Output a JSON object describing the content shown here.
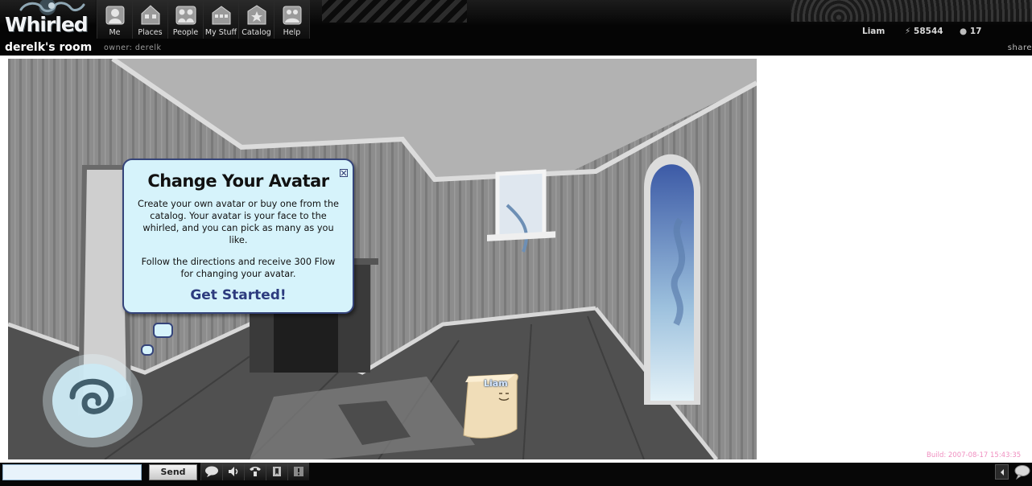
{
  "header": {
    "logo": "Whirled",
    "nav": [
      {
        "id": "me",
        "label": "Me",
        "icon": "person-icon"
      },
      {
        "id": "places",
        "label": "Places",
        "icon": "house-icon"
      },
      {
        "id": "people",
        "label": "People",
        "icon": "people-icon"
      },
      {
        "id": "mystuff",
        "label": "My Stuff",
        "icon": "stuff-icon"
      },
      {
        "id": "catalog",
        "label": "Catalog",
        "icon": "catalog-icon"
      },
      {
        "id": "help",
        "label": "Help",
        "icon": "help-icon"
      }
    ],
    "room_name": "derelk's room",
    "owner": "owner: derelk",
    "user_name": "Liam",
    "flow": "58544",
    "gold": "17",
    "share": "share"
  },
  "room": {
    "avatar_name": "Liam"
  },
  "popup": {
    "title": "Change Your Avatar",
    "body": "Create your own avatar or buy one from the catalog. Your avatar is your face to the whirled, and you can pick as many as you like.",
    "body2": "Follow the directions and receive 300 Flow for changing your avatar.",
    "cta": "Get Started!"
  },
  "build": "Build: 2007-08-17 15:43:35",
  "chat": {
    "input_value": "",
    "send_label": "Send",
    "tools": [
      "chat-bubble-icon",
      "volume-icon",
      "phone-icon",
      "bookmark-icon",
      "info-icon"
    ]
  },
  "colors": {
    "popup_bg": "#d6f3fb",
    "popup_border": "#35447a",
    "cta": "#2d3b7e",
    "build_text": "#f08fc0",
    "header_bg": "#050505"
  }
}
